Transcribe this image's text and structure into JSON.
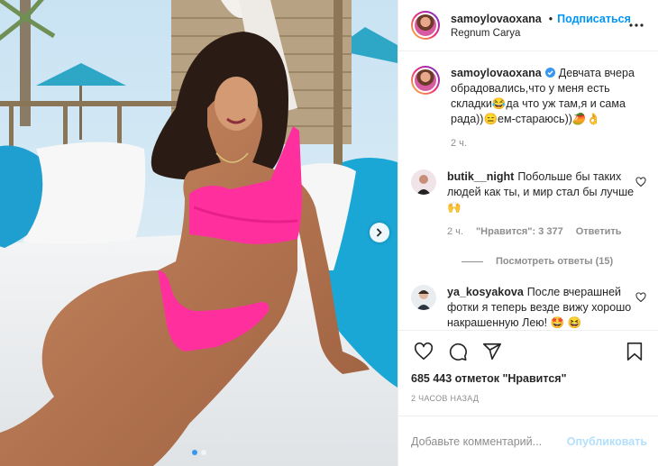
{
  "post": {
    "author": "samoylovaoxana",
    "follow_label": "Подписаться",
    "separator": "•",
    "location": "Regnum Carya"
  },
  "caption": {
    "author": "samoylovaoxana",
    "text": "Девчата вчера обрадовались,что у меня есть складки😂да что уж там,я и сама рада))😑ем-стараюсь))🥭👌",
    "time": "2 ч."
  },
  "comments": [
    {
      "username": "butik__night",
      "text": "Побольше бы таких людей как ты, и мир стал бы лучше🙌",
      "time": "2 ч.",
      "likes": "\"Нравится\": 3 377",
      "reply_label": "Ответить",
      "view_replies": "Посмотреть ответы (15)"
    },
    {
      "username": "ya_kosyakova",
      "text": "После вчерашней фотки я теперь везде вижу хорошо накрашенную Лею! 🤩 😆"
    }
  ],
  "likes_count": "685 443 отметок \"Нравится\"",
  "posted_ago": "2 часов назад",
  "comment_box": {
    "placeholder": "Добавьте комментарий...",
    "publish_label": "Опубликовать"
  },
  "icons": {
    "verified": "verified-badge-icon",
    "more": "more-options-icon",
    "like": "heart-icon",
    "comment": "comment-icon",
    "share": "share-icon",
    "save": "bookmark-icon",
    "next": "chevron-right-icon"
  },
  "colors": {
    "accent": "#0095f6",
    "publish_disabled": "#b2dffc",
    "swimsuit": "#ff2f9e",
    "pool_blue": "#1aa7d6"
  },
  "carousel": {
    "slides": 2,
    "active": 1
  }
}
